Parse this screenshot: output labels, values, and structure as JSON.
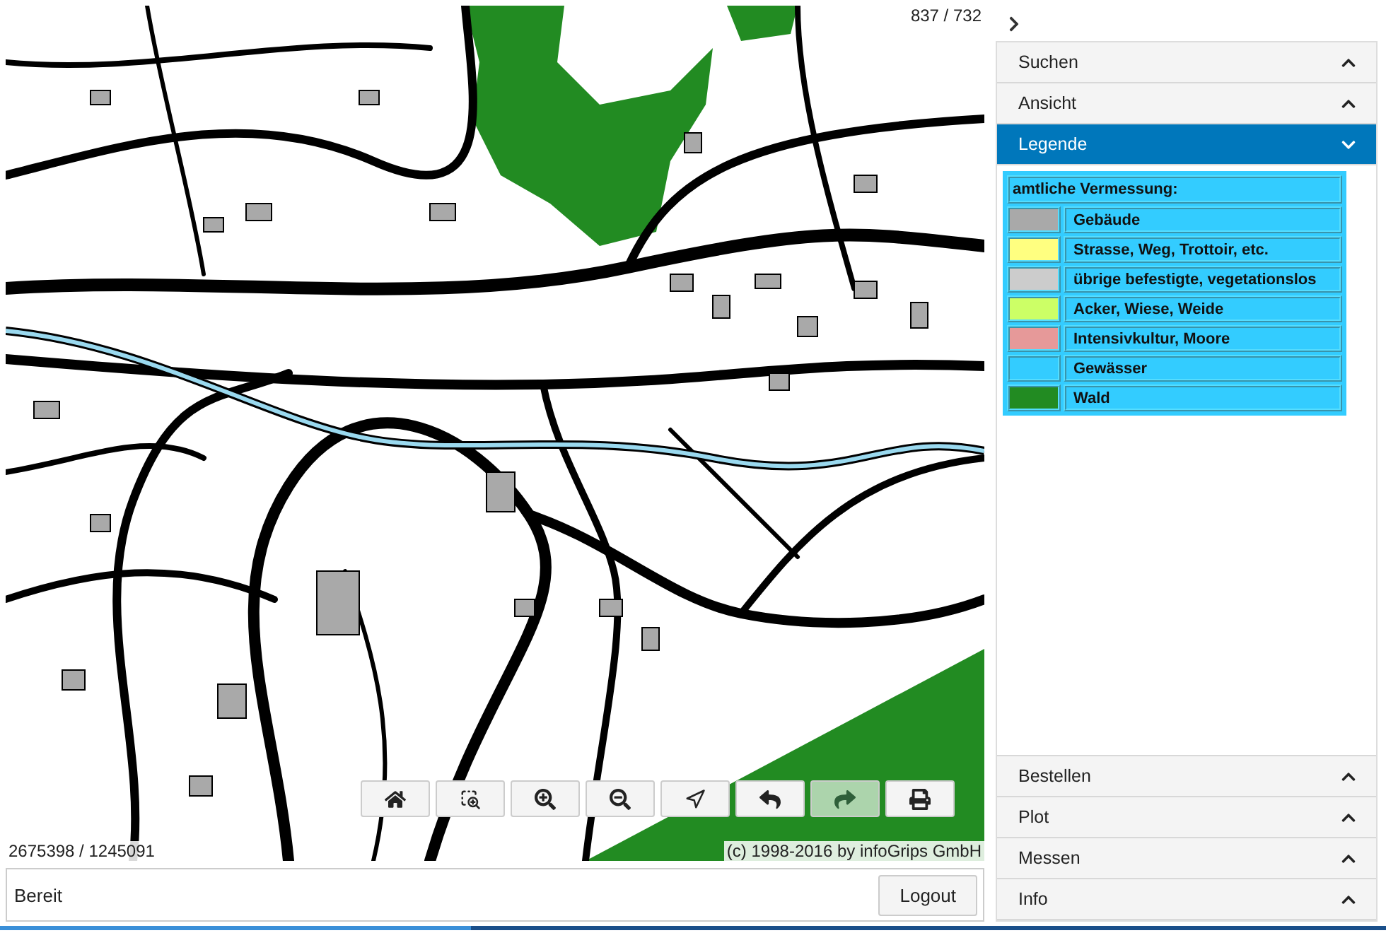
{
  "map": {
    "scale_readout": "837 / 732",
    "coordinates": "2675398 / 1245091",
    "copyright": "(c) 1998-2016 by infoGrips GmbH",
    "tools": [
      {
        "kind": "home",
        "active": false
      },
      {
        "kind": "zoom-extent",
        "active": false
      },
      {
        "kind": "zoom-in",
        "active": false
      },
      {
        "kind": "zoom-out",
        "active": false
      },
      {
        "kind": "locate",
        "active": false
      },
      {
        "kind": "undo",
        "active": false
      },
      {
        "kind": "redo",
        "active": true
      },
      {
        "kind": "print",
        "active": false
      }
    ]
  },
  "status_bar": {
    "text": "Bereit",
    "button": "Logout"
  },
  "sidebar": {
    "sections": [
      {
        "label": "Suchen",
        "expanded": false
      },
      {
        "label": "Ansicht",
        "expanded": false
      },
      {
        "label": "Legende",
        "expanded": true,
        "legend": {
          "heading": "amtliche Vermessung:",
          "items": [
            {
              "label": "Gebäude",
              "color": "#a9a9a9"
            },
            {
              "label": "Strasse, Weg, Trottoir, etc.",
              "color": "#ffff80"
            },
            {
              "label": "übrige befestigte, vegetationslos",
              "color": "#cccccc"
            },
            {
              "label": "Acker, Wiese, Weide",
              "color": "#ccff66"
            },
            {
              "label": "Intensivkultur, Moore",
              "color": "#e69999"
            },
            {
              "label": "Gewässer",
              "color": "#33ccff"
            },
            {
              "label": "Wald",
              "color": "#228b22"
            }
          ]
        }
      },
      {
        "label": "Bestellen",
        "expanded": false
      },
      {
        "label": "Plot",
        "expanded": false
      },
      {
        "label": "Messen",
        "expanded": false
      },
      {
        "label": "Info",
        "expanded": false
      }
    ]
  }
}
